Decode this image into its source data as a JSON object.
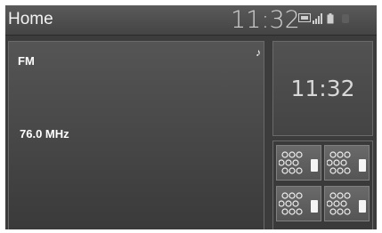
{
  "header": {
    "title": "Home",
    "clock": "11:32",
    "status_icons": [
      "bluetooth-icon",
      "signal-bars-icon",
      "battery-icon",
      "network-icon"
    ]
  },
  "radio": {
    "band": "FM",
    "frequency": "76.0 MHz",
    "music_icon": "music-note-icon"
  },
  "clock_tile": {
    "time": "11:32"
  },
  "presets": [
    {
      "icon": "preset-icon"
    },
    {
      "icon": "preset-icon"
    },
    {
      "icon": "preset-icon"
    },
    {
      "icon": "preset-icon"
    }
  ]
}
